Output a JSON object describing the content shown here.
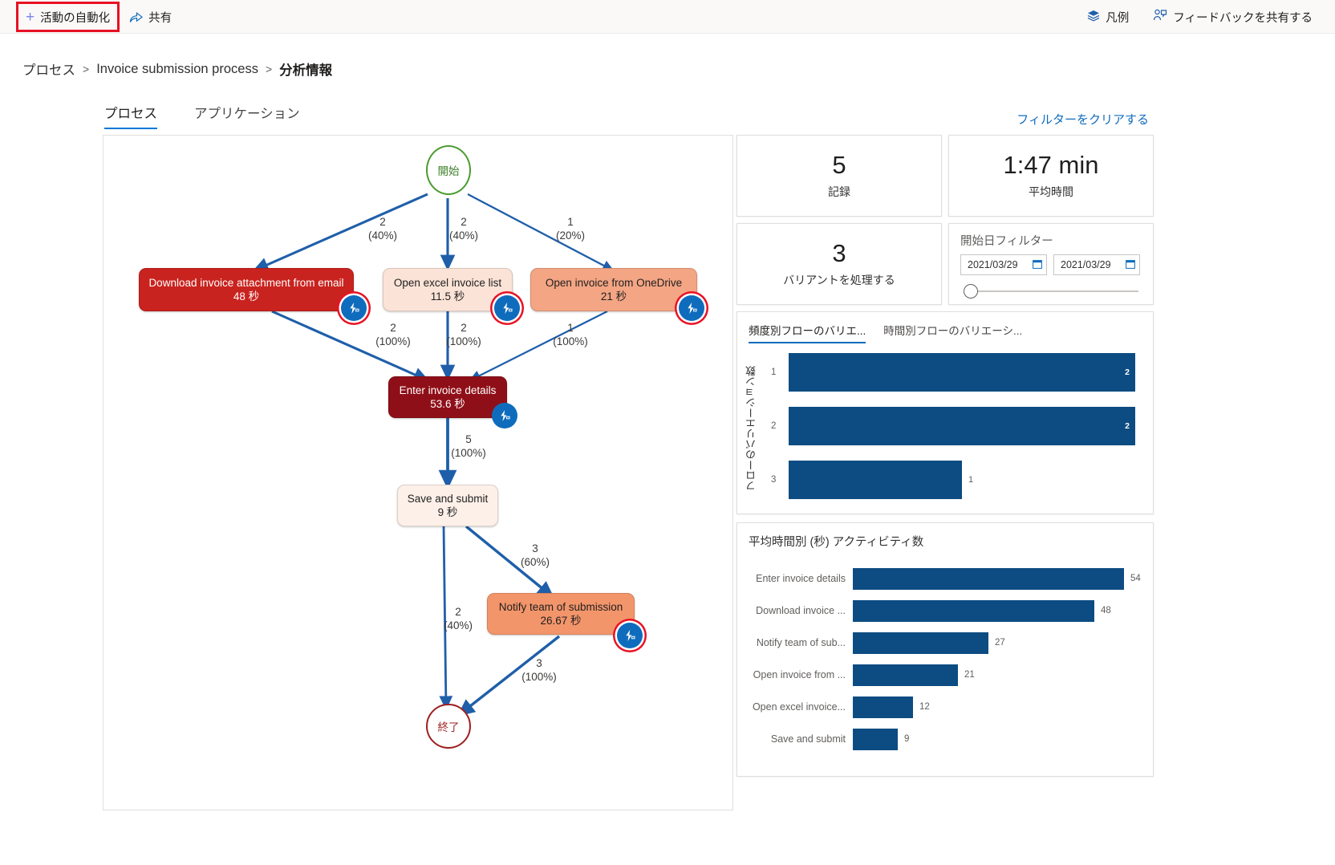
{
  "commandbar": {
    "automate_label": "活動の自動化",
    "share_label": "共有",
    "legend_label": "凡例",
    "feedback_label": "フィードバックを共有する"
  },
  "breadcrumb": {
    "items": [
      "プロセス",
      "Invoice submission process",
      "分析情報"
    ],
    "separator": ">"
  },
  "pivot": {
    "tabs": [
      {
        "label": "プロセス",
        "active": true
      },
      {
        "label": "アプリケーション",
        "active": false
      }
    ]
  },
  "clear_filter_label": "フィルターをクリアする",
  "flow": {
    "start_label": "開始",
    "end_label": "終了",
    "nodes": [
      {
        "id": "download",
        "name": "Download invoice attachment from email",
        "duration": "48 秒",
        "fill": "#c9231f",
        "text": "#ffffff"
      },
      {
        "id": "excel",
        "name": "Open excel invoice list",
        "duration": "11.5 秒",
        "fill": "#fbe3d7",
        "text": "#201f1e"
      },
      {
        "id": "onedrive",
        "name": "Open invoice from OneDrive",
        "duration": "21 秒",
        "fill": "#f3a584",
        "text": "#201f1e"
      },
      {
        "id": "enter",
        "name": "Enter invoice details",
        "duration": "53.6 秒",
        "fill": "#8f0f18",
        "text": "#ffffff"
      },
      {
        "id": "save",
        "name": "Save and submit",
        "duration": "9 秒",
        "fill": "#fdf0e9",
        "text": "#201f1e"
      },
      {
        "id": "notify",
        "name": "Notify team of submission",
        "duration": "26.67 秒",
        "fill": "#f3956b",
        "text": "#201f1e"
      }
    ],
    "edges": [
      {
        "count": "2",
        "pct": "(40%)"
      },
      {
        "count": "2",
        "pct": "(40%)"
      },
      {
        "count": "1",
        "pct": "(20%)"
      },
      {
        "count": "2",
        "pct": "(100%)"
      },
      {
        "count": "2",
        "pct": "(100%)"
      },
      {
        "count": "1",
        "pct": "(100%)"
      },
      {
        "count": "5",
        "pct": "(100%)"
      },
      {
        "count": "3",
        "pct": "(60%)"
      },
      {
        "count": "2",
        "pct": "(40%)"
      },
      {
        "count": "3",
        "pct": "(100%)"
      }
    ]
  },
  "kpis": [
    {
      "value": "5",
      "label": "記録"
    },
    {
      "value": "1:47 min",
      "label": "平均時間"
    },
    {
      "value": "3",
      "label": "バリアントを処理する"
    }
  ],
  "date_filter": {
    "title": "開始日フィルター",
    "start": "2021/03/29",
    "end": "2021/03/29"
  },
  "variation_panel": {
    "tabs": [
      {
        "label": "頻度別フローのバリエ...",
        "active": true
      },
      {
        "label": "時間別フローのバリエーシ...",
        "active": false
      }
    ]
  },
  "chart_data": [
    {
      "type": "bar",
      "orientation": "horizontal",
      "title": "頻度別フローのバリエ...",
      "ylabel": "フローのバリエーション数",
      "xlabel": "",
      "categories": [
        "1",
        "2",
        "3"
      ],
      "values": [
        2,
        2,
        1
      ],
      "labels": [
        "2",
        "2",
        "1"
      ],
      "xlim": [
        0,
        2
      ],
      "grid": false,
      "legend": "none",
      "bar_color": "#0d4c82"
    },
    {
      "type": "bar",
      "orientation": "horizontal",
      "title": "平均時間別 (秒) アクティビティ数",
      "ylabel": "",
      "xlabel": "",
      "categories": [
        "Enter invoice details",
        "Download invoice ...",
        "Notify team of sub...",
        "Open invoice from ...",
        "Open excel invoice...",
        "Save and submit"
      ],
      "values": [
        54,
        48,
        27,
        21,
        12,
        9
      ],
      "labels": [
        "54",
        "48",
        "27",
        "21",
        "12",
        "9"
      ],
      "xlim": [
        0,
        54
      ],
      "grid": false,
      "legend": "none",
      "bar_color": "#0d4c82"
    }
  ]
}
